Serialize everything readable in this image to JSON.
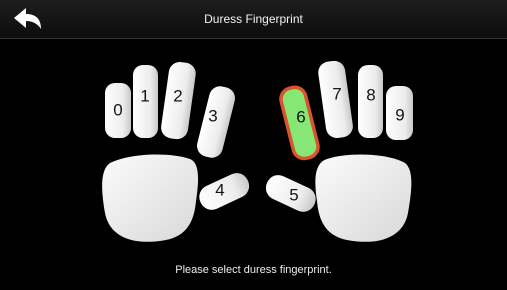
{
  "header": {
    "title": "Duress Fingerprint",
    "back_icon": "back-arrow-icon"
  },
  "fingers": [
    {
      "label": "0",
      "selected": false
    },
    {
      "label": "1",
      "selected": false
    },
    {
      "label": "2",
      "selected": false
    },
    {
      "label": "3",
      "selected": false
    },
    {
      "label": "4",
      "selected": false
    },
    {
      "label": "5",
      "selected": false
    },
    {
      "label": "6",
      "selected": true
    },
    {
      "label": "7",
      "selected": false
    },
    {
      "label": "8",
      "selected": false
    },
    {
      "label": "9",
      "selected": false
    }
  ],
  "status": {
    "message": "Please select duress fingerprint."
  },
  "colors": {
    "background": "#000000",
    "finger": "#e6e6e6",
    "selected_fill": "#86e676",
    "selected_outline": "#d9532c"
  }
}
